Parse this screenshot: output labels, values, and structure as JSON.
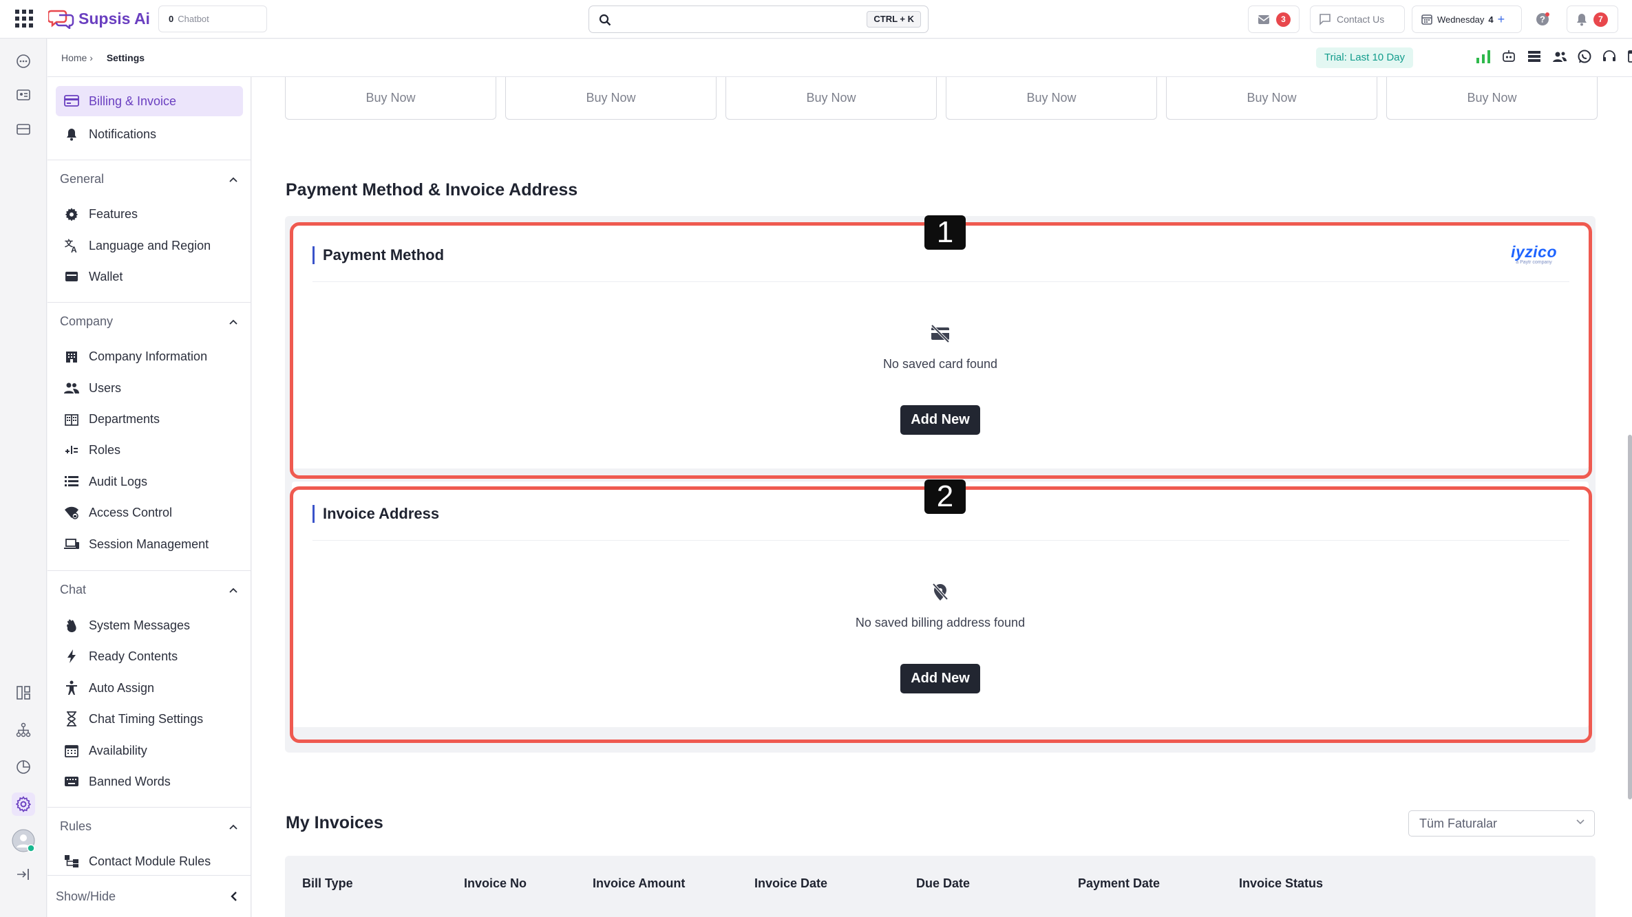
{
  "topbar": {
    "app_name": "Supsis Ai",
    "chatbot_count": "0",
    "chatbot_label": "Chatbot",
    "search_shortcut": "CTRL + K",
    "inbox_badge": "3",
    "contact_label": "Contact Us",
    "day_label": "Wednesday",
    "day_number": "4",
    "day_plus": "+",
    "notifications_badge": "7"
  },
  "subheader": {
    "breadcrumb_home": "Home",
    "breadcrumb_sep": "›",
    "breadcrumb_current": "Settings",
    "trial_label": "Trial: Last 10 Day"
  },
  "nav": {
    "top_items": [
      {
        "label": "Billing & Invoice",
        "icon": "billing-icon",
        "active": true
      },
      {
        "label": "Notifications",
        "icon": "bell-icon",
        "active": false
      }
    ],
    "sections": [
      {
        "title": "General",
        "items": [
          {
            "label": "Features",
            "icon": "gear-icon"
          },
          {
            "label": "Language and Region",
            "icon": "translate-icon"
          },
          {
            "label": "Wallet",
            "icon": "wallet-icon"
          }
        ]
      },
      {
        "title": "Company",
        "items": [
          {
            "label": "Company Information",
            "icon": "building-icon"
          },
          {
            "label": "Users",
            "icon": "users-icon"
          },
          {
            "label": "Departments",
            "icon": "departments-icon"
          },
          {
            "label": "Roles",
            "icon": "roles-icon"
          },
          {
            "label": "Audit Logs",
            "icon": "list-icon"
          },
          {
            "label": "Access Control",
            "icon": "access-icon"
          },
          {
            "label": "Session Management",
            "icon": "devices-icon"
          }
        ]
      },
      {
        "title": "Chat",
        "items": [
          {
            "label": "System Messages",
            "icon": "waving-hand-icon"
          },
          {
            "label": "Ready Contents",
            "icon": "bolt-icon"
          },
          {
            "label": "Auto Assign",
            "icon": "person-icon"
          },
          {
            "label": "Chat Timing Settings",
            "icon": "hourglass-icon"
          },
          {
            "label": "Availability",
            "icon": "calendar-icon"
          },
          {
            "label": "Banned Words",
            "icon": "keyboard-icon"
          }
        ]
      },
      {
        "title": "Rules",
        "items": [
          {
            "label": "Contact Module Rules",
            "icon": "rules-icon"
          }
        ]
      }
    ],
    "show_hide_label": "Show/Hide"
  },
  "main": {
    "buy_buttons": [
      "Buy Now",
      "Buy Now",
      "Buy Now",
      "Buy Now",
      "Buy Now",
      "Buy Now"
    ],
    "payment_section_title": "Payment Method & Invoice Address",
    "payment_card": {
      "title": "Payment Method",
      "provider_brand": "iyzico",
      "provider_sub": "a Paytr company",
      "empty_text": "No saved card found",
      "add_label": "Add New"
    },
    "invoice_card": {
      "title": "Invoice Address",
      "empty_text": "No saved billing address found",
      "add_label": "Add New"
    },
    "markers": [
      "1",
      "2"
    ],
    "invoices_title": "My Invoices",
    "filter_value": "Tüm Faturalar",
    "table_headers": [
      "Bill Type",
      "Invoice No",
      "Invoice Amount",
      "Invoice Date",
      "Due Date",
      "Payment Date",
      "Invoice Status"
    ]
  },
  "colors": {
    "brand": "#6a3fc0",
    "accent_blue": "#3a53c9",
    "highlight": "#ef5a50",
    "trial_text": "#129c8c",
    "badge": "#e8474c"
  }
}
